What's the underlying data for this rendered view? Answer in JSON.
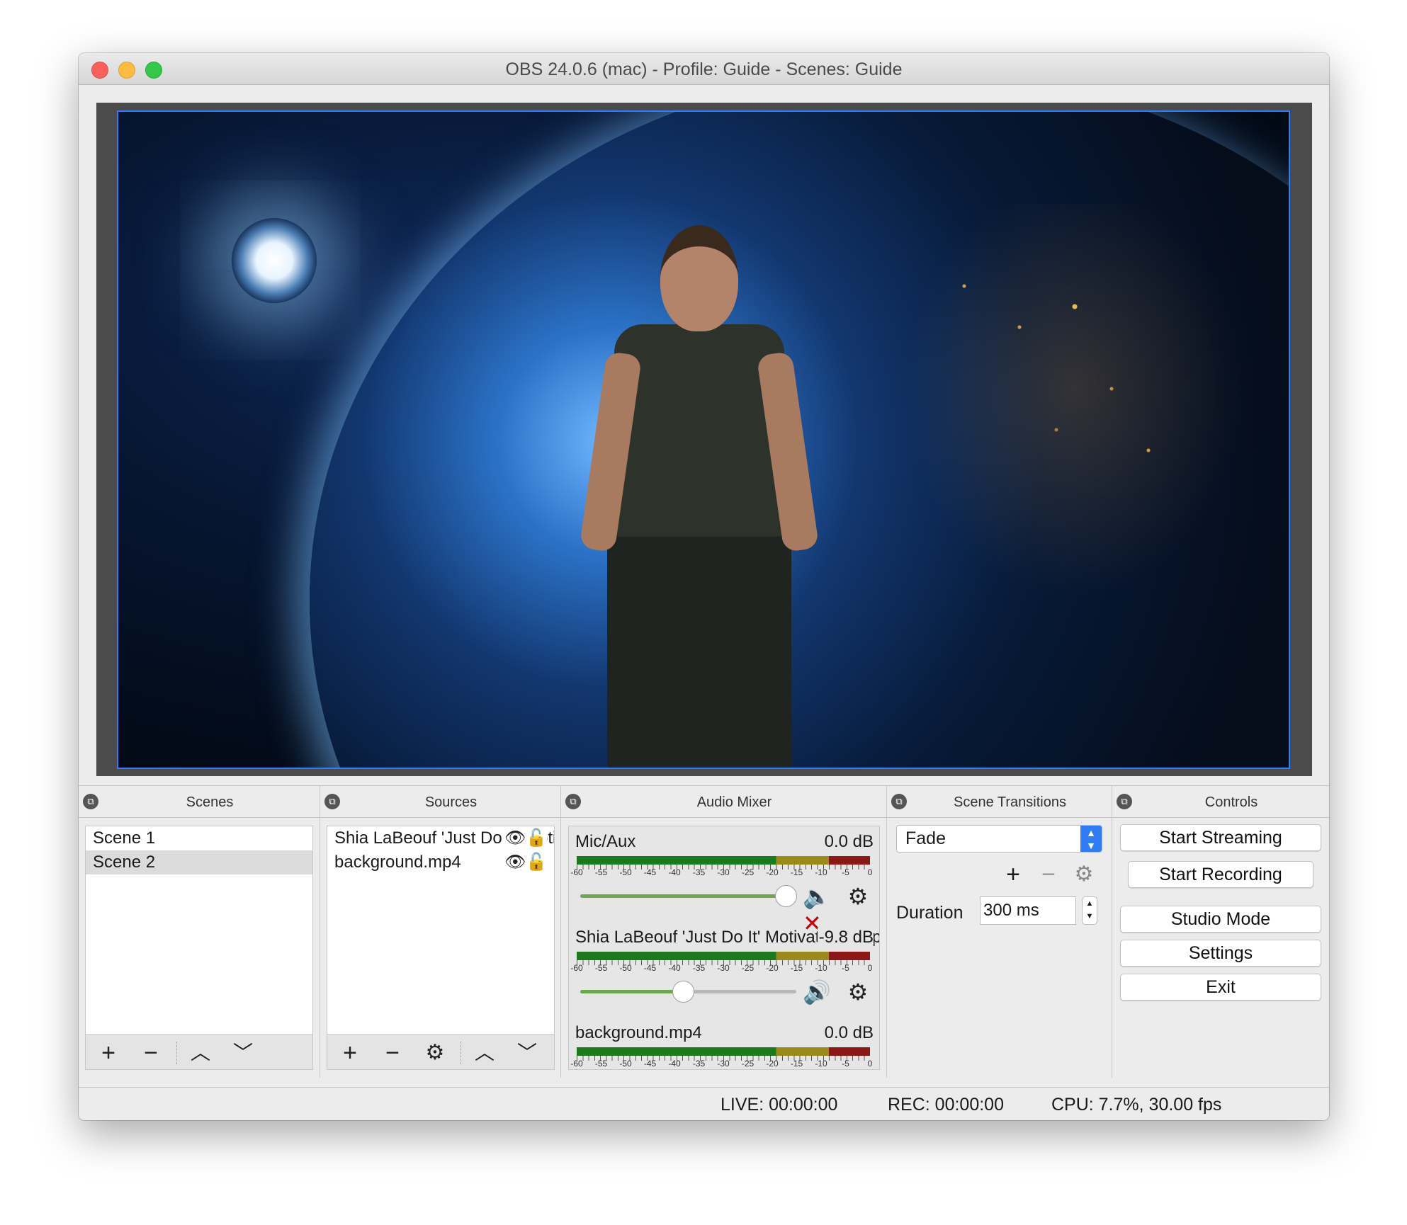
{
  "window": {
    "title": "OBS 24.0.6 (mac) - Profile: Guide - Scenes: Guide"
  },
  "docks": {
    "scenes": {
      "title": "Scenes",
      "items": [
        {
          "label": "Scene 1",
          "selected": false
        },
        {
          "label": "Scene 2",
          "selected": true
        }
      ],
      "toolbar": [
        "plus-icon",
        "minus-icon",
        "arrow-up-icon",
        "arrow-down-icon"
      ]
    },
    "sources": {
      "title": "Sources",
      "items": [
        {
          "label": "Shia LaBeouf 'Just Do It' Motivational Speech",
          "visible_icon": "eye-icon",
          "lock_icon": "lock-icon"
        },
        {
          "label": "background.mp4",
          "visible_icon": "eye-icon",
          "lock_icon": "lock-icon"
        }
      ],
      "toolbar": [
        "plus-icon",
        "minus-icon",
        "gear-icon",
        "arrow-up-icon",
        "arrow-down-icon"
      ]
    },
    "audio_mixer": {
      "title": "Audio Mixer",
      "meter_labels": [
        "-60",
        "-55",
        "-50",
        "-45",
        "-40",
        "-35",
        "-30",
        "-25",
        "-20",
        "-15",
        "-10",
        "-5",
        "0"
      ],
      "channels": [
        {
          "name": "Mic/Aux",
          "db": "0.0 dB",
          "volume_fraction": 1.0,
          "muted": true
        },
        {
          "name": "Shia LaBeouf 'Just Do It' Motivational Speech",
          "db": "-9.8 dB",
          "volume_fraction": 0.5,
          "muted": false
        },
        {
          "name": "background.mp4",
          "db": "0.0 dB",
          "volume_fraction": 1.0,
          "muted": false
        }
      ]
    },
    "scene_transitions": {
      "title": "Scene Transitions",
      "selected": "Fade",
      "duration_label": "Duration",
      "duration_value": "300 ms"
    },
    "controls": {
      "title": "Controls",
      "buttons": [
        "Start Streaming",
        "Start Recording",
        "Studio Mode",
        "Settings",
        "Exit"
      ]
    }
  },
  "statusbar": {
    "live": "LIVE: 00:00:00",
    "rec": "REC: 00:00:00",
    "cpu": "CPU: 7.7%, 30.00 fps"
  },
  "colors": {
    "accent": "#2f7cf6",
    "muted_red": "#d00000",
    "slider_green": "#6fa84c"
  }
}
